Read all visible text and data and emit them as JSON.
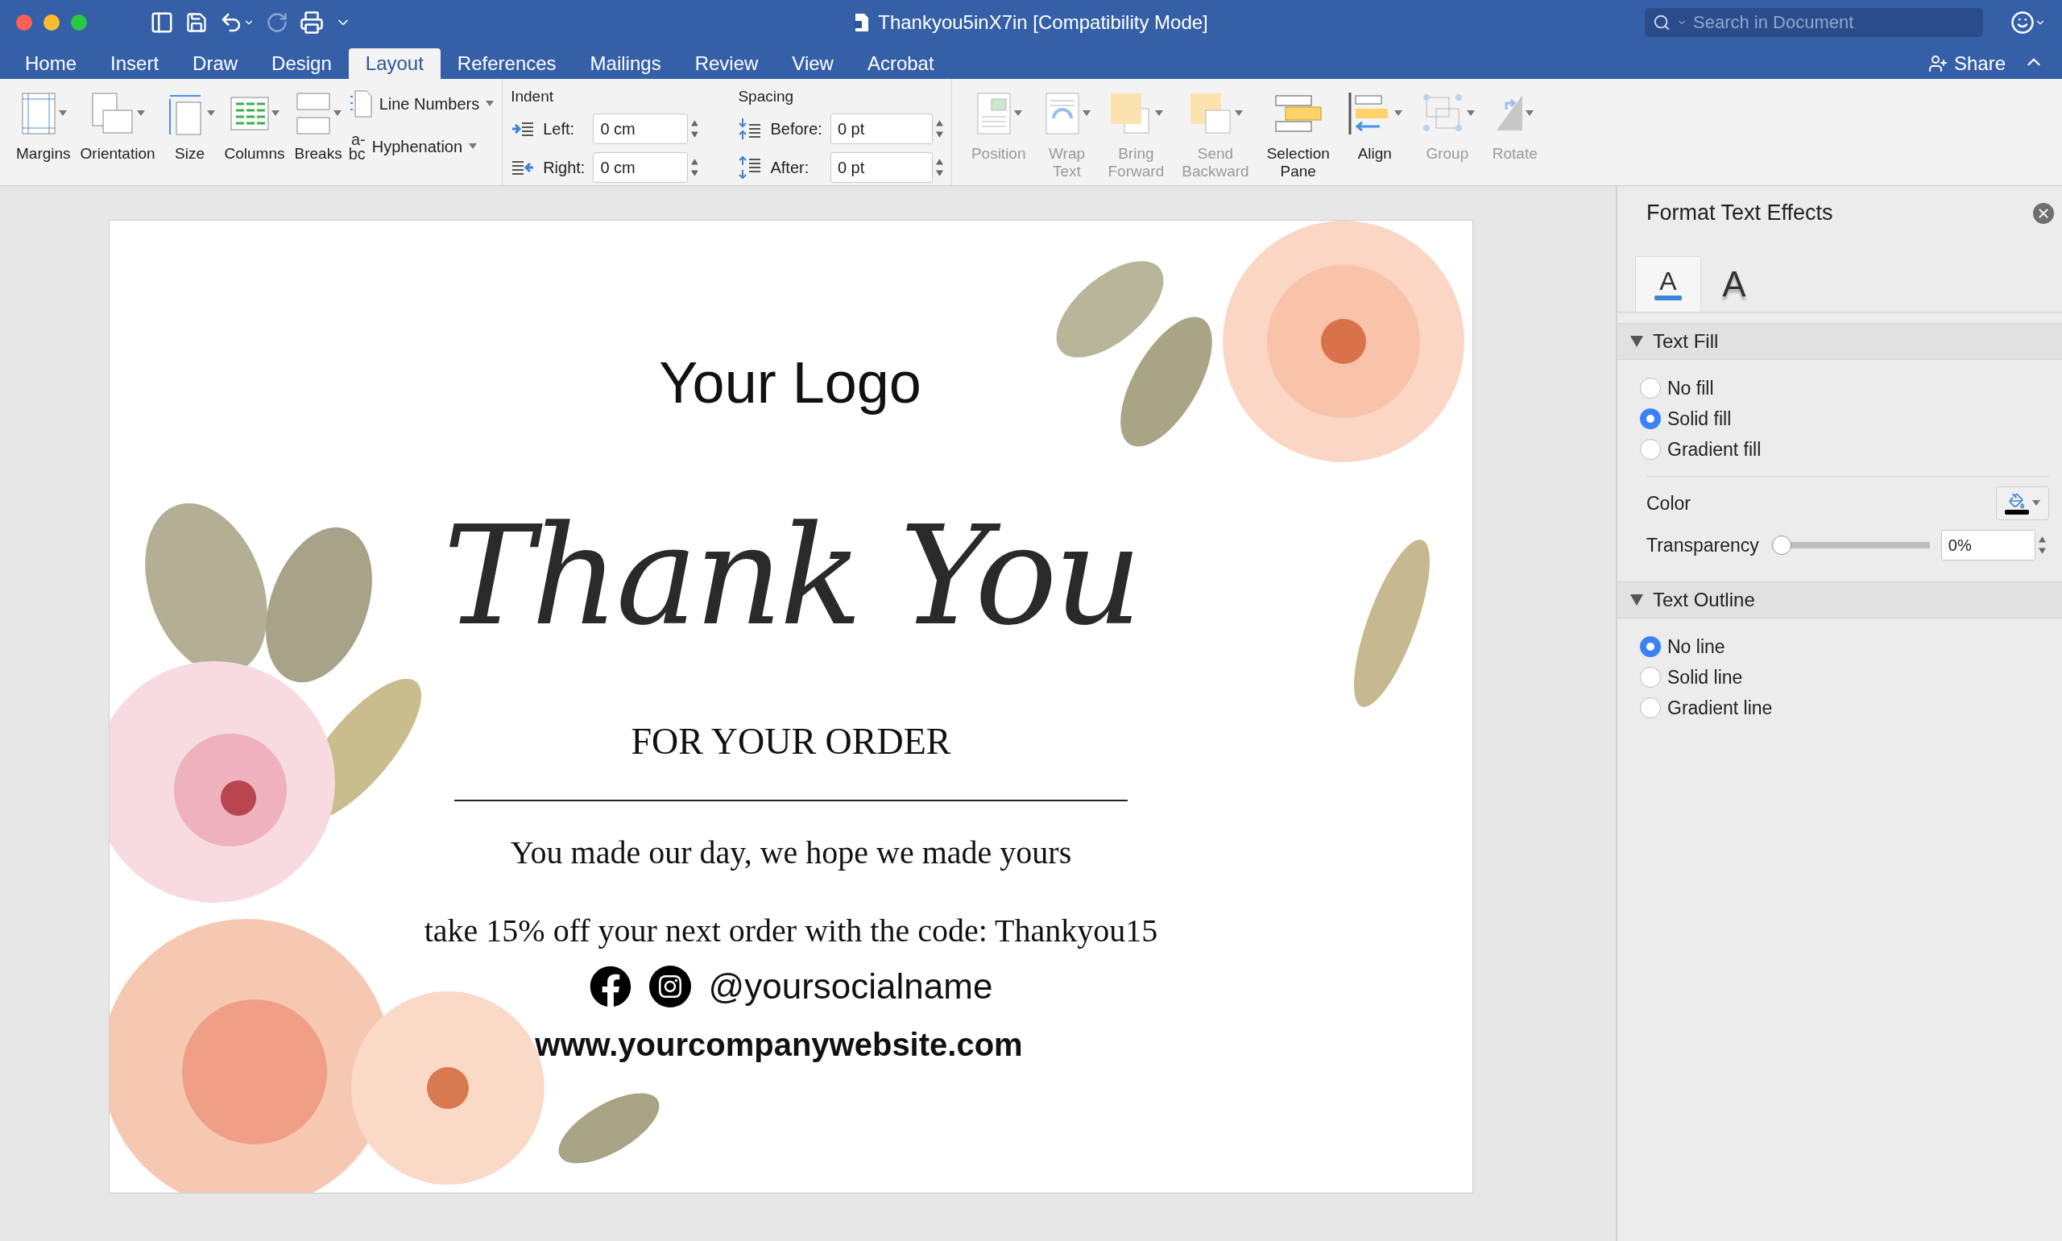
{
  "window": {
    "title": "Thankyou5inX7in [Compatibility Mode]",
    "search_placeholder": "Search in Document"
  },
  "tabs": [
    {
      "label": "Home",
      "selected": false
    },
    {
      "label": "Insert",
      "selected": false
    },
    {
      "label": "Draw",
      "selected": false
    },
    {
      "label": "Design",
      "selected": false
    },
    {
      "label": "Layout",
      "selected": true
    },
    {
      "label": "References",
      "selected": false
    },
    {
      "label": "Mailings",
      "selected": false
    },
    {
      "label": "Review",
      "selected": false
    },
    {
      "label": "View",
      "selected": false
    },
    {
      "label": "Acrobat",
      "selected": false
    }
  ],
  "share": "Share",
  "ribbon": {
    "page_setup": [
      {
        "label": "Margins",
        "kind": "margins"
      },
      {
        "label": "Orientation",
        "kind": "orientation"
      },
      {
        "label": "Size",
        "kind": "size"
      },
      {
        "label": "Columns",
        "kind": "columns"
      },
      {
        "label": "Breaks",
        "kind": "breaks"
      }
    ],
    "line_numbers": "Line Numbers",
    "hyphenation": {
      "label": "Hyphenation",
      "glyph_upper": "a-",
      "glyph_lower": "bc"
    },
    "indent": {
      "title": "Indent",
      "left_label": "Left:",
      "left_value": "0 cm",
      "right_label": "Right:",
      "right_value": "0 cm"
    },
    "spacing": {
      "title": "Spacing",
      "before_label": "Before:",
      "before_value": "0 pt",
      "after_label": "After:",
      "after_value": "0 pt"
    },
    "arrange": [
      {
        "label": "Position",
        "kind": "position",
        "disabled": true
      },
      {
        "label": "Wrap Text",
        "kind": "wrap",
        "disabled": true
      },
      {
        "label": "Bring Forward",
        "kind": "bring",
        "disabled": true
      },
      {
        "label": "Send Backward",
        "kind": "send",
        "disabled": true
      },
      {
        "label": "Selection Pane",
        "kind": "selection",
        "disabled": false
      },
      {
        "label": "Align",
        "kind": "align",
        "disabled": false
      },
      {
        "label": "Group",
        "kind": "group",
        "disabled": true
      },
      {
        "label": "Rotate",
        "kind": "rotate",
        "disabled": true
      }
    ]
  },
  "document": {
    "logo": "Your Logo",
    "headline": "Thank You",
    "subtitle": "FOR YOUR ORDER",
    "tagline": "You made our day, we hope we made yours",
    "offer": "take 15% off your next order with the code: Thankyou15",
    "social_handle": "@yoursocialname",
    "website": "www.yourcompanywebsite.com"
  },
  "panel": {
    "title": "Format Text Effects",
    "tabs": [
      {
        "glyph": "A",
        "kind": "fill",
        "selected": true
      },
      {
        "glyph": "A",
        "kind": "effects",
        "selected": false
      }
    ],
    "sections": [
      {
        "title": "Text Fill",
        "expanded": true,
        "options": [
          {
            "label": "No fill",
            "selected": false
          },
          {
            "label": "Solid fill",
            "selected": true
          },
          {
            "label": "Gradient fill",
            "selected": false
          }
        ],
        "color_label": "Color",
        "transparency_label": "Transparency",
        "transparency": {
          "level": 0,
          "value": "0%"
        }
      },
      {
        "title": "Text Outline",
        "expanded": true,
        "options": [
          {
            "label": "No line",
            "selected": true
          },
          {
            "label": "Solid line",
            "selected": false
          },
          {
            "label": "Gradient line",
            "selected": false
          }
        ]
      }
    ]
  }
}
